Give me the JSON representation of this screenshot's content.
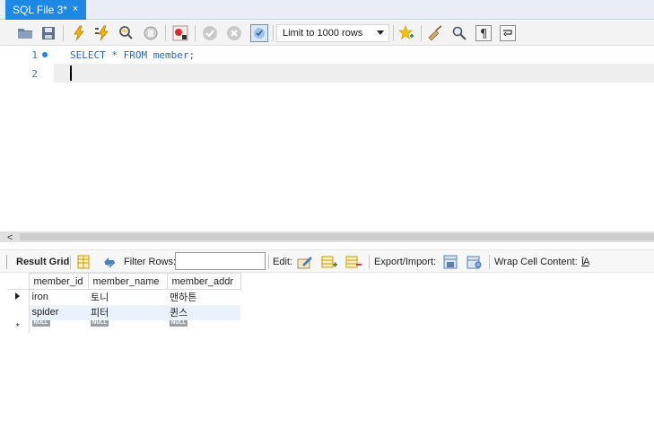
{
  "tab": {
    "title": "SQL File 3*",
    "close": "×"
  },
  "toolbar": {
    "limit_rows": "Limit to 1000 rows",
    "icons": [
      "open-folder-icon",
      "save-icon",
      "execute-icon",
      "execute-current-icon",
      "explain-icon",
      "stop-icon",
      "toggle-error-icon",
      "commit-icon",
      "rollback-icon",
      "autocommit-icon",
      "add-snippet-icon",
      "beautify-icon",
      "find-icon",
      "invisible-chars-icon",
      "wrap-icon"
    ]
  },
  "editor": {
    "lines": [
      {
        "number": "1",
        "code": "SELECT * FROM member;"
      },
      {
        "number": "2",
        "code": ""
      }
    ]
  },
  "scrollbar": {
    "left_arrow": "<"
  },
  "results_toolbar": {
    "result_grid": "Result Grid",
    "filter_rows": "Filter Rows:",
    "filter_value": "",
    "edit": "Edit:",
    "export_import": "Export/Import:",
    "wrap_cell": "Wrap Cell Content:",
    "wrap_icon_text": "ĪA"
  },
  "grid": {
    "columns": [
      "member_id",
      "member_name",
      "member_addr"
    ],
    "rows": [
      [
        "iron",
        "토니",
        "맨하튼"
      ],
      [
        "spider",
        "피터",
        "퀸스"
      ]
    ],
    "null_label": "NULL",
    "new_row_marker": "*"
  }
}
